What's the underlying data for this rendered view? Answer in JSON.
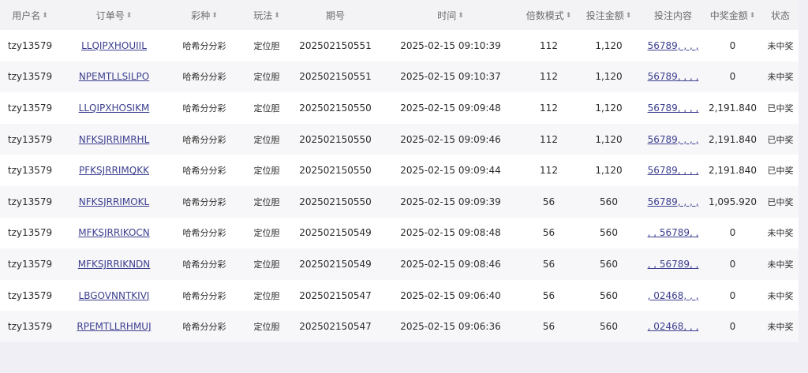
{
  "columns": [
    {
      "label": "用户名",
      "sortable": true
    },
    {
      "label": "订单号",
      "sortable": true
    },
    {
      "label": "彩种",
      "sortable": true
    },
    {
      "label": "玩法",
      "sortable": true
    },
    {
      "label": "期号",
      "sortable": false
    },
    {
      "label": "时间",
      "sortable": true
    },
    {
      "label": "倍数模式",
      "sortable": true
    },
    {
      "label": "投注金额",
      "sortable": true
    },
    {
      "label": "投注内容",
      "sortable": false
    },
    {
      "label": "中奖金额",
      "sortable": true
    },
    {
      "label": "状态",
      "sortable": false
    }
  ],
  "rows": [
    {
      "user": "tzy13579",
      "order": "LLQIPXHOUIIL",
      "lottery": "哈希分分彩",
      "play": "定位胆",
      "period": "202502150551",
      "time": "2025-02-15 09:10:39",
      "multiple": "112",
      "amount": "1,120",
      "content": "56789, , , ,",
      "prize": "0",
      "status": "未中奖"
    },
    {
      "user": "tzy13579",
      "order": "NPEMTLLSILPO",
      "lottery": "哈希分分彩",
      "play": "定位胆",
      "period": "202502150551",
      "time": "2025-02-15 09:10:37",
      "multiple": "112",
      "amount": "1,120",
      "content": "56789, , , ,",
      "prize": "0",
      "status": "未中奖"
    },
    {
      "user": "tzy13579",
      "order": "LLQIPXHOSIKM",
      "lottery": "哈希分分彩",
      "play": "定位胆",
      "period": "202502150550",
      "time": "2025-02-15 09:09:48",
      "multiple": "112",
      "amount": "1,120",
      "content": "56789, , , ,",
      "prize": "2,191.840",
      "status": "已中奖"
    },
    {
      "user": "tzy13579",
      "order": "NFKSJRRIMRHL",
      "lottery": "哈希分分彩",
      "play": "定位胆",
      "period": "202502150550",
      "time": "2025-02-15 09:09:46",
      "multiple": "112",
      "amount": "1,120",
      "content": "56789, , , ,",
      "prize": "2,191.840",
      "status": "已中奖"
    },
    {
      "user": "tzy13579",
      "order": "PFKSJRRIMQKK",
      "lottery": "哈希分分彩",
      "play": "定位胆",
      "period": "202502150550",
      "time": "2025-02-15 09:09:44",
      "multiple": "112",
      "amount": "1,120",
      "content": "56789, , , ,",
      "prize": "2,191.840",
      "status": "已中奖"
    },
    {
      "user": "tzy13579",
      "order": "NFKSJRRIMOKL",
      "lottery": "哈希分分彩",
      "play": "定位胆",
      "period": "202502150550",
      "time": "2025-02-15 09:09:39",
      "multiple": "56",
      "amount": "560",
      "content": "56789, , , ,",
      "prize": "1,095.920",
      "status": "已中奖"
    },
    {
      "user": "tzy13579",
      "order": "MFKSJRRIKOCN",
      "lottery": "哈希分分彩",
      "play": "定位胆",
      "period": "202502150549",
      "time": "2025-02-15 09:08:48",
      "multiple": "56",
      "amount": "560",
      "content": ", , 56789, ,",
      "prize": "0",
      "status": "未中奖"
    },
    {
      "user": "tzy13579",
      "order": "MFKSJRRIKNDN",
      "lottery": "哈希分分彩",
      "play": "定位胆",
      "period": "202502150549",
      "time": "2025-02-15 09:08:46",
      "multiple": "56",
      "amount": "560",
      "content": ", , 56789, ,",
      "prize": "0",
      "status": "未中奖"
    },
    {
      "user": "tzy13579",
      "order": "LBGOVNNTKIVJ",
      "lottery": "哈希分分彩",
      "play": "定位胆",
      "period": "202502150547",
      "time": "2025-02-15 09:06:40",
      "multiple": "56",
      "amount": "560",
      "content": ", 02468, , ,",
      "prize": "0",
      "status": "未中奖"
    },
    {
      "user": "tzy13579",
      "order": "RPEMTLLRHMUJ",
      "lottery": "哈希分分彩",
      "play": "定位胆",
      "period": "202502150547",
      "time": "2025-02-15 09:06:36",
      "multiple": "56",
      "amount": "560",
      "content": ", 02468, , ,",
      "prize": "0",
      "status": "未中奖"
    }
  ]
}
